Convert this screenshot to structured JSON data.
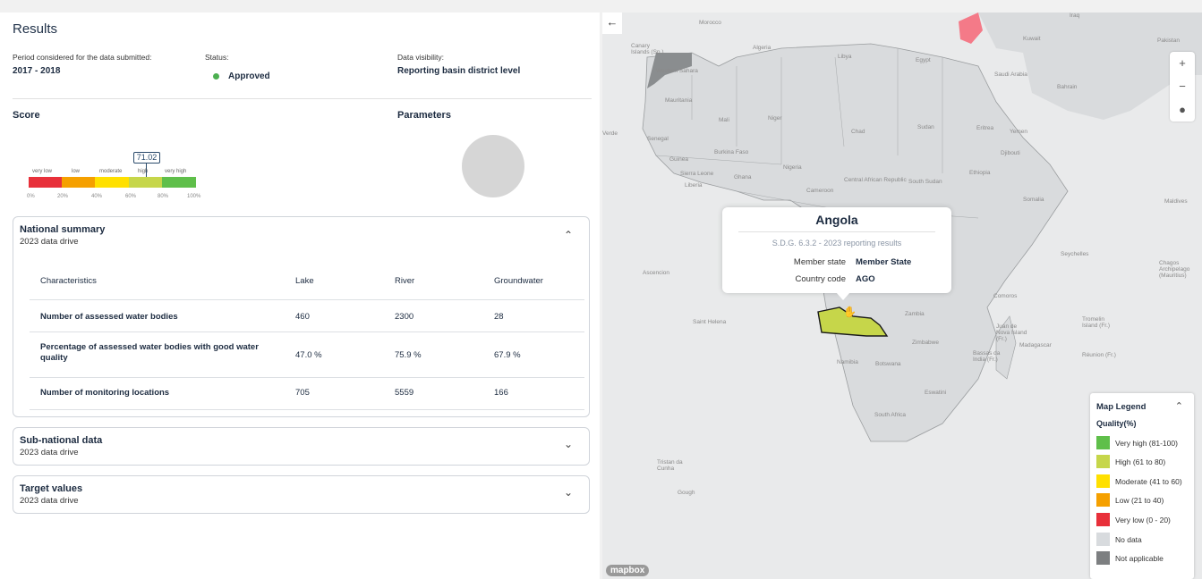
{
  "results": {
    "title": "Results",
    "period_label": "Period considered for the data submitted:",
    "period_value": "2017 - 2018",
    "status_label": "Status:",
    "status_value": "Approved",
    "visibility_label": "Data visibility:",
    "visibility_value": "Reporting basin district level"
  },
  "score": {
    "title": "Score",
    "value": "71.02",
    "scale_labels": [
      "very low",
      "low",
      "moderate",
      "high",
      "very high"
    ],
    "ticks": [
      "0%",
      "20%",
      "40%",
      "60%",
      "80%",
      "100%"
    ],
    "bar_colors": [
      "#e8303a",
      "#f5a000",
      "#ffe000",
      "#c6d64a",
      "#5fbf4a"
    ]
  },
  "parameters": {
    "title": "Parameters"
  },
  "national_summary": {
    "title": "National summary",
    "subtitle": "2023 data drive",
    "headers": [
      "Characteristics",
      "Lake",
      "River",
      "Groundwater"
    ],
    "rows": [
      {
        "label": "Number of assessed water bodies",
        "lake": "460",
        "river": "2300",
        "groundwater": "28"
      },
      {
        "label": "Percentage of assessed water bodies with good water quality",
        "lake": "47.0 %",
        "river": "75.9 %",
        "groundwater": "67.9 %"
      },
      {
        "label": "Number of monitoring locations",
        "lake": "705",
        "river": "5559",
        "groundwater": "166"
      }
    ]
  },
  "sub_national": {
    "title": "Sub-national data",
    "subtitle": "2023 data drive"
  },
  "target_values": {
    "title": "Target values",
    "subtitle": "2023 data drive"
  },
  "tooltip": {
    "title": "Angola",
    "subtitle": "S.D.G. 6.3.2 - 2023 reporting results",
    "member_label": "Member state",
    "member_value": "Member State",
    "code_label": "Country code",
    "code_value": "AGO"
  },
  "map_labels": {
    "morocco": "Morocco",
    "algeria": "Algeria",
    "libya": "Libya",
    "egypt": "Egypt",
    "kuwait": "Kuwait",
    "saudi": "Saudi Arabia",
    "bahrain": "Bahrain",
    "western_sahara": "Western Sahara",
    "mauritania": "Mauritania",
    "mali": "Mali",
    "niger": "Niger",
    "chad": "Chad",
    "sudan": "Sudan",
    "eritrea": "Eritrea",
    "yemen": "Yemen",
    "senegal": "Senegal",
    "burkina": "Burkina Faso",
    "guinea": "Guinea",
    "nigeria": "Nigeria",
    "ethiopia": "Ethiopia",
    "sierra": "Sierra Leone",
    "liberia": "Liberia",
    "ghana": "Ghana",
    "car": "Central African Republic",
    "south_sudan": "South Sudan",
    "djibouti": "Djibouti",
    "cameroon": "Cameroon",
    "somalia": "Somalia",
    "ascencion": "Ascencion",
    "seychelles": "Seychelles",
    "chagos": "Chagos Archipelago (Mauritius)",
    "maldives": "Maldives",
    "comoros": "Comoros",
    "saint_helena": "Saint Helena",
    "zambia": "Zambia",
    "tromelin": "Tromelin Island (Fr.)",
    "juan": "Juan de Nova Island (Fr.)",
    "madagascar": "Madagascar",
    "zimbabwe": "Zimbabwe",
    "bassas": "Bassas da India (Fr.)",
    "reunion": "Réunion (Fr.)",
    "namibia": "Namibia",
    "botswana": "Botswana",
    "eswatini": "Eswatini",
    "south_africa": "South Africa",
    "tristan": "Tristan da Cunha",
    "gough": "Gough",
    "verde": "Verde",
    "canary": "Canary Islands (Sp.)",
    "pakistan": "Pakistan",
    "iraq": "Iraq"
  },
  "legend": {
    "title": "Map Legend",
    "subtitle": "Quality(%)",
    "items": [
      {
        "label": "Very high (81-100)",
        "color": "#5fbf4a"
      },
      {
        "label": "High (61 to 80)",
        "color": "#c6d64a"
      },
      {
        "label": "Moderate (41 to 60)",
        "color": "#ffe000"
      },
      {
        "label": "Low (21 to 40)",
        "color": "#f5a000"
      },
      {
        "label": "Very low (0 - 20)",
        "color": "#e8303a"
      },
      {
        "label": "No data",
        "color": "#d8dbde"
      },
      {
        "label": "Not applicable",
        "color": "#7d7f81"
      }
    ]
  },
  "mapbox": "mapbox"
}
